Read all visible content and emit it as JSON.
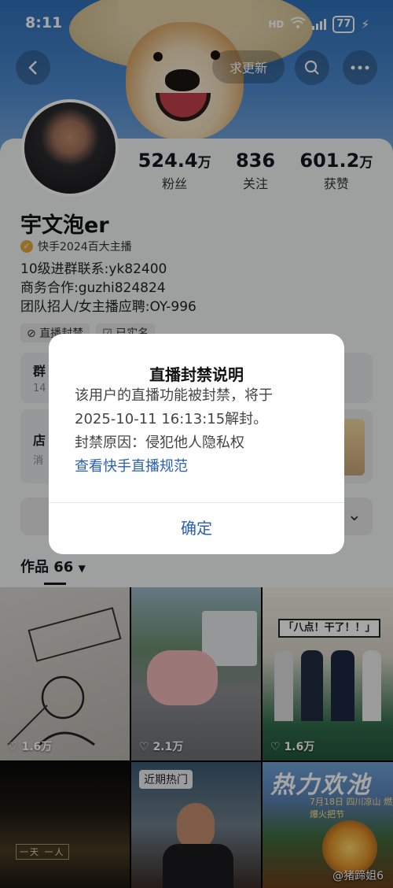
{
  "status_bar": {
    "time": "8:11",
    "network": "HD",
    "battery": "77"
  },
  "nav": {
    "update_label": "求更新"
  },
  "profile": {
    "stats": [
      {
        "num": "524.4",
        "unit": "万",
        "label": "粉丝"
      },
      {
        "num": "836",
        "unit": "",
        "label": "关注"
      },
      {
        "num": "601.2",
        "unit": "万",
        "label": "获赞"
      }
    ],
    "name": "宇文泡er",
    "verification": "快手2024百大主播",
    "bio": [
      "10级进群联系:yk82400",
      "商务合作:guzhi824824",
      "团队招人/女主播应聘:OY-996"
    ],
    "tags": [
      "直播封禁",
      "已实名"
    ]
  },
  "panels": {
    "group_title": "群",
    "group_sub": "14",
    "shop_title": "店",
    "shop_sub": "消"
  },
  "works": {
    "label": "作品",
    "count": "66"
  },
  "videos": [
    {
      "likes": "1.6万"
    },
    {
      "likes": "2.1万"
    },
    {
      "likes": "1.6万",
      "banner": "「八点！干了！！」"
    },
    {
      "caption": "一天 一人"
    },
    {
      "badge": "近期热门"
    },
    {
      "title": "热力欢池",
      "subtitle": "7月18日 四川凉山 燃爆火把节"
    }
  ],
  "watermark": "@猪蹄姐6",
  "dialog": {
    "title": "直播封禁说明",
    "line1": "该用户的直播功能被封禁，将于",
    "line2": "2025-10-11 16:13:15解封。",
    "line3": "封禁原因：侵犯他人隐私权",
    "link": "查看快手直播规范",
    "confirm": "确定"
  }
}
